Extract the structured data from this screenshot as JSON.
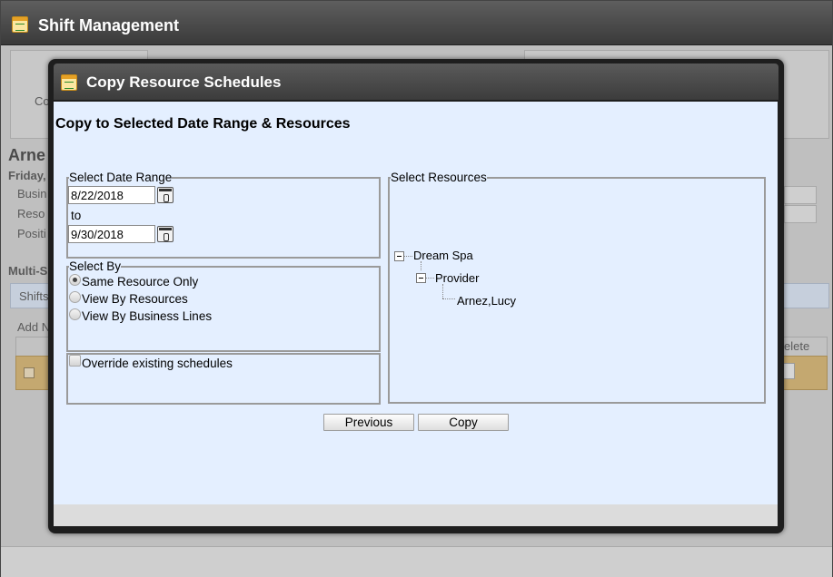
{
  "background": {
    "title": "Shift Management",
    "resource_name_partial": "Arne",
    "date_partial": "Friday,",
    "field_labels": [
      "Busin",
      "Reso",
      "Positi"
    ],
    "section_partial": "Multi-S",
    "tab_partial": "Shifts",
    "add_button_partial": "Add N",
    "tile_label_partial": "Co",
    "grid_header_delete_partial": "elete"
  },
  "modal": {
    "title": "Copy Resource Schedules",
    "heading": "Copy to Selected Date Range & Resources",
    "date_range": {
      "legend": "Select Date Range",
      "from_value": "8/22/2018",
      "to_label": "to",
      "to_value": "9/30/2018"
    },
    "select_by": {
      "legend": "Select By",
      "options": [
        {
          "label": "Same Resource Only",
          "checked": true
        },
        {
          "label": "View By Resources",
          "checked": false
        },
        {
          "label": "View By Business Lines",
          "checked": false
        }
      ]
    },
    "override": {
      "label": "Override existing schedules",
      "checked": false
    },
    "resources": {
      "legend": "Select Resources",
      "tree": {
        "root": "Dream Spa",
        "child": "Provider",
        "leaf": "Arnez,Lucy"
      }
    },
    "buttons": {
      "previous": "Previous",
      "copy": "Copy"
    }
  },
  "colors": {
    "modal_body": "#e4efff",
    "titlebar_dark": "#3c3c3c",
    "icon_accent": "#e5a126"
  }
}
